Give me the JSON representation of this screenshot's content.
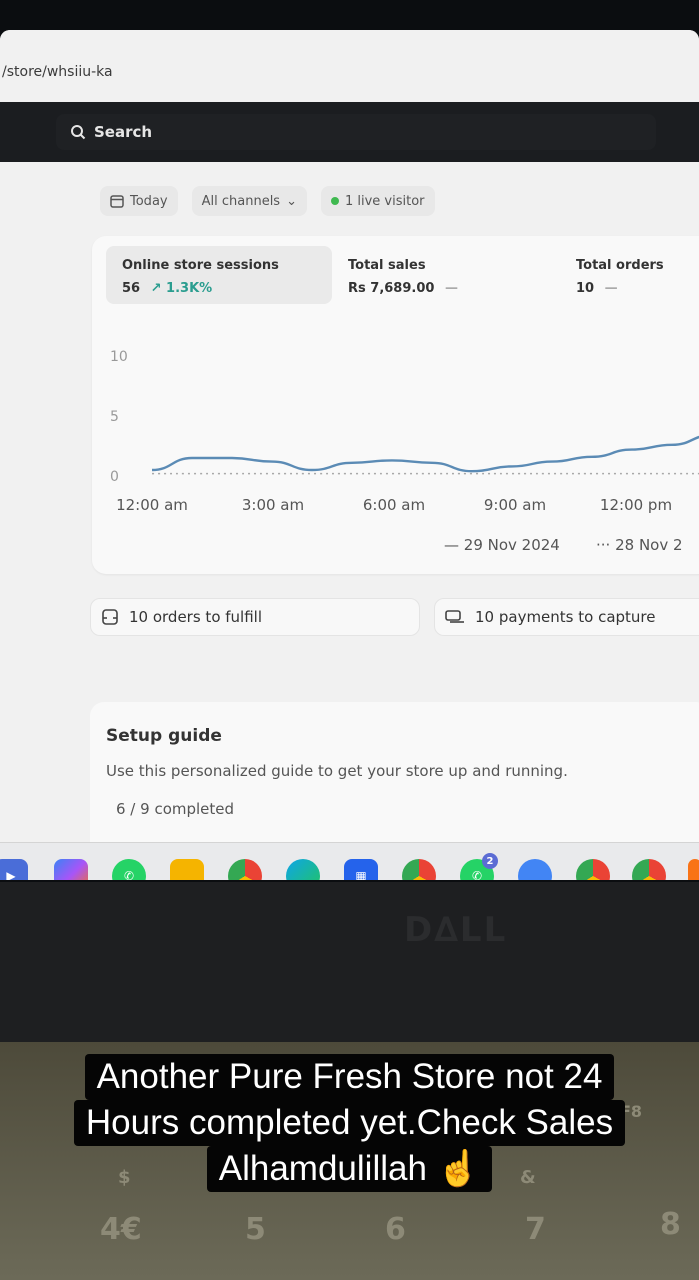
{
  "browser": {
    "url": "/store/whsiiu-ka"
  },
  "topbar": {
    "search_label": "Search"
  },
  "filters": {
    "date": "Today",
    "channels": "All channels",
    "visitors": "1 live visitor"
  },
  "metrics": [
    {
      "label": "Online store sessions",
      "value": "56",
      "change": "↗ 1.3K%"
    },
    {
      "label": "Total sales",
      "value": "Rs 7,689.00",
      "change": "—"
    },
    {
      "label": "Total orders",
      "value": "10",
      "change": "—"
    }
  ],
  "chart_data": {
    "type": "line",
    "x": [
      "12:00 am",
      "3:00 am",
      "6:00 am",
      "9:00 am",
      "12:00 pm"
    ],
    "yticks": [
      "10",
      "5",
      "0"
    ],
    "ylim": [
      0,
      10
    ],
    "series": [
      {
        "name": "29 Nov 2024",
        "style": "solid",
        "color": "#5b8bb5",
        "values": [
          0.5,
          1.5,
          1.5,
          1.2,
          0.5,
          1.1,
          1.3,
          1.1,
          0.4,
          0.8,
          1.2,
          1.6,
          2.2,
          2.6,
          3.4
        ]
      },
      {
        "name": "28 Nov 2",
        "style": "dotted",
        "color": "#a9a9a9",
        "values": [
          0.2,
          0.2,
          0.2,
          0.2,
          0.2,
          0.2,
          0.2,
          0.2,
          0.2,
          0.2,
          0.2,
          0.2,
          0.2,
          0.2,
          0.2
        ]
      }
    ],
    "legend": [
      "29 Nov 2024",
      "28 Nov 2"
    ]
  },
  "tasks": {
    "fulfill": "10 orders to fulfill",
    "payments": "10 payments to capture"
  },
  "setup": {
    "title": "Setup guide",
    "description": "Use this personalized guide to get your store up and running.",
    "progress": "6 / 9 completed"
  },
  "taskbar": {
    "whatsapp_badge": "2"
  },
  "laptop": {
    "brand": "D∆LL"
  },
  "caption": {
    "line1": "Another Pure Fresh Store not 24",
    "line2": "Hours completed yet.Check Sales",
    "line3": "Alhamdulillah ☝"
  },
  "keys": [
    "4€",
    "5",
    "6",
    "7",
    "8",
    "$",
    "&",
    "F8"
  ]
}
